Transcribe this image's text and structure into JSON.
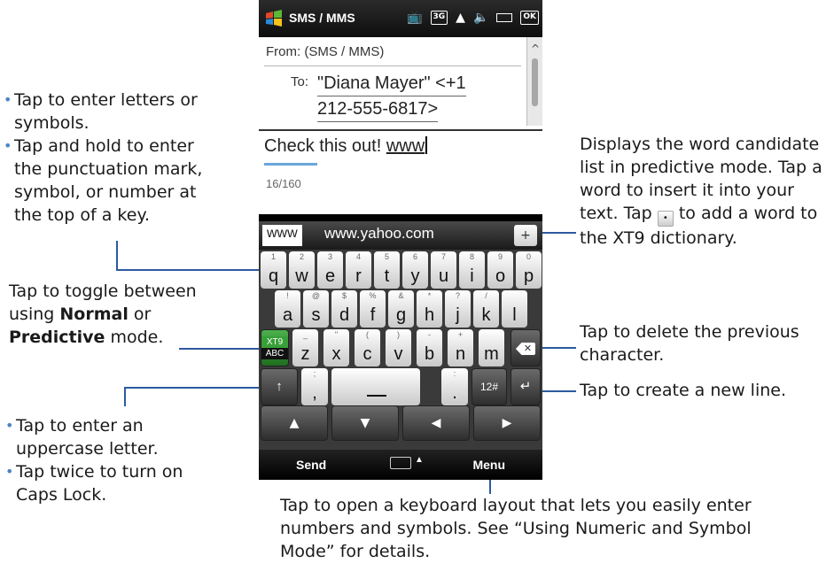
{
  "annotations": {
    "letters": [
      "Tap to enter letters or symbols.",
      "Tap and hold to enter the punctuation mark, symbol, or number at the top of a key."
    ],
    "toggle": {
      "pre": "Tap to toggle between using ",
      "normal": "Normal",
      "mid": " or ",
      "predictive": "Predictive",
      "post": " mode."
    },
    "shift": [
      "Tap to enter an uppercase letter.",
      "Tap twice to turn on Caps Lock."
    ],
    "candidates": "Displays the word candidate list in predictive mode. Tap a word to insert it into your text. Tap",
    "candidates_tail": "to add a word to the XT9 dictionary.",
    "delete": "Tap to delete the previous character.",
    "newline": "Tap to create a new line.",
    "numeric": "Tap to open a keyboard layout that lets you easily enter numbers and symbols. See “Using Numeric and Symbol Mode” for details."
  },
  "statusbar": {
    "title": "SMS / MMS",
    "icons": [
      "tv-icon",
      "3g-icon",
      "signal-icon",
      "speaker-icon",
      "battery-icon",
      "ok-icon"
    ],
    "ok_label": "OK",
    "g3_label": "3G"
  },
  "compose": {
    "from_label": "From: (SMS / MMS)",
    "to_label": "To:",
    "to_line1": "\"Diana Mayer\" <+1",
    "to_line2": "212-555-6817>",
    "message_text": "Check this out! ",
    "message_typed": "www",
    "counter": "16/160"
  },
  "candidates": {
    "selected": "www",
    "suggestion": "www.yahoo.com",
    "add_label": "+"
  },
  "keyboard": {
    "row1": [
      [
        "1",
        "q"
      ],
      [
        "2",
        "w"
      ],
      [
        "3",
        "e"
      ],
      [
        "4",
        "r"
      ],
      [
        "5",
        "t"
      ],
      [
        "6",
        "y"
      ],
      [
        "7",
        "u"
      ],
      [
        "8",
        "i"
      ],
      [
        "9",
        "o"
      ],
      [
        "0",
        "p"
      ]
    ],
    "row2": [
      [
        "!",
        "a"
      ],
      [
        "@",
        "s"
      ],
      [
        "$",
        "d"
      ],
      [
        "%",
        "f"
      ],
      [
        "&",
        "g"
      ],
      [
        "*",
        "h"
      ],
      [
        "?",
        "j"
      ],
      [
        "/",
        "k"
      ],
      [
        "",
        "l"
      ]
    ],
    "row3": [
      [
        "_",
        "z"
      ],
      [
        "\"",
        "x"
      ],
      [
        "(",
        "c"
      ],
      [
        ")",
        "v"
      ],
      [
        "-",
        "b"
      ],
      [
        "+",
        "n"
      ],
      [
        "",
        "m"
      ]
    ],
    "xt9_top": "XT9",
    "xt9_bottom": "ABC",
    "delete_glyph": "✕",
    "shift_glyph": "↑",
    "comma_alt": ";",
    "comma": ",",
    "period_alt": ":",
    "period": ".",
    "numeric_label": "12#",
    "enter_glyph": "↵",
    "nav": [
      "▲",
      "▼",
      "◀",
      "▶"
    ]
  },
  "softkeys": {
    "left": "Send",
    "right": "Menu",
    "up": "▲"
  }
}
